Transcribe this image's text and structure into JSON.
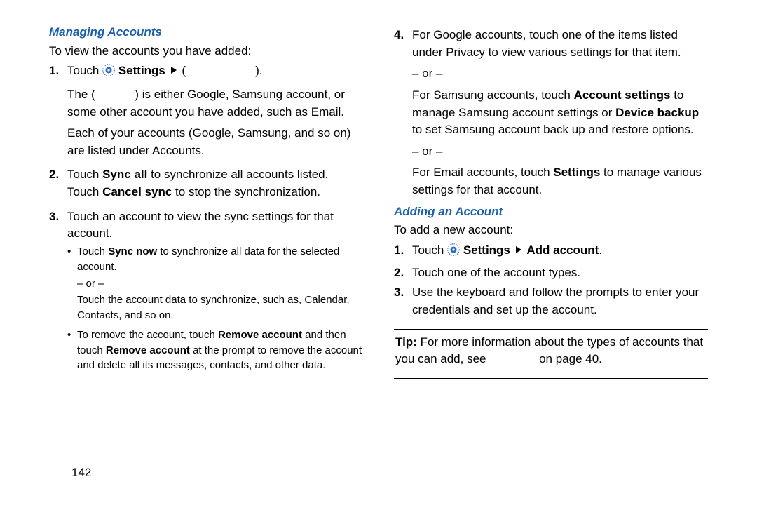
{
  "page_number": "142",
  "left": {
    "heading": "Managing Accounts",
    "intro": "To view the accounts you have added:",
    "steps": [
      {
        "num": "1.",
        "pre": "Touch ",
        "settings": "Settings",
        "tail_prefix": " (",
        "tail_suffix": ").",
        "p2_prefix": "The (",
        "p2_suffix": ") is either Google, Samsung account, or some other account you have added, such as Email.",
        "p3": "Each of your accounts (Google, Samsung, and so on) are listed under Accounts."
      },
      {
        "num": "2.",
        "pre": "Touch ",
        "bold1": "Sync all",
        "mid": " to synchronize all accounts listed. Touch ",
        "bold2": "Cancel sync",
        "tail": " to stop the synchronization."
      },
      {
        "num": "3.",
        "text": "Touch an account to view the sync settings for that account.",
        "bullets": [
          {
            "pre": "Touch ",
            "bold": "Sync now",
            "tail": " to synchronize all data for the selected account.",
            "or": "– or –",
            "after": "Touch the account data to synchronize, such as, Calendar, Contacts, and so on."
          },
          {
            "pre": "To remove the account, touch ",
            "bold": "Remove account",
            "mid": " and then touch ",
            "bold2": "Remove account",
            "tail": " at the prompt to remove the account and delete all its messages, contacts, and other data."
          }
        ]
      }
    ]
  },
  "right": {
    "step4": {
      "num": "4.",
      "line1": "For Google accounts, touch one of the items listed under Privacy to view various settings for that item.",
      "or1": "– or –",
      "line2_pre": "For Samsung accounts, touch ",
      "line2_b1": "Account settings",
      "line2_mid": " to manage Samsung account settings or ",
      "line2_b2": "Device backup",
      "line2_tail": " to set Samsung account back up and restore options.",
      "or2": "– or –",
      "line3_pre": "For Email accounts, touch ",
      "line3_b": "Settings",
      "line3_tail": " to manage various settings for that account."
    },
    "heading2": "Adding an Account",
    "intro2": "To add a new account:",
    "add_steps": [
      {
        "num": "1.",
        "pre": "Touch ",
        "settings": "Settings",
        "add": "Add account",
        "tail": "."
      },
      {
        "num": "2.",
        "text": "Touch one of the account types."
      },
      {
        "num": "3.",
        "text": "Use the keyboard and follow the prompts to enter your credentials and set up the account."
      }
    ],
    "tip": {
      "label": "Tip:",
      "body_pre": " For more information about the types of accounts that you can add, see ",
      "body_post": " on page 40."
    }
  }
}
